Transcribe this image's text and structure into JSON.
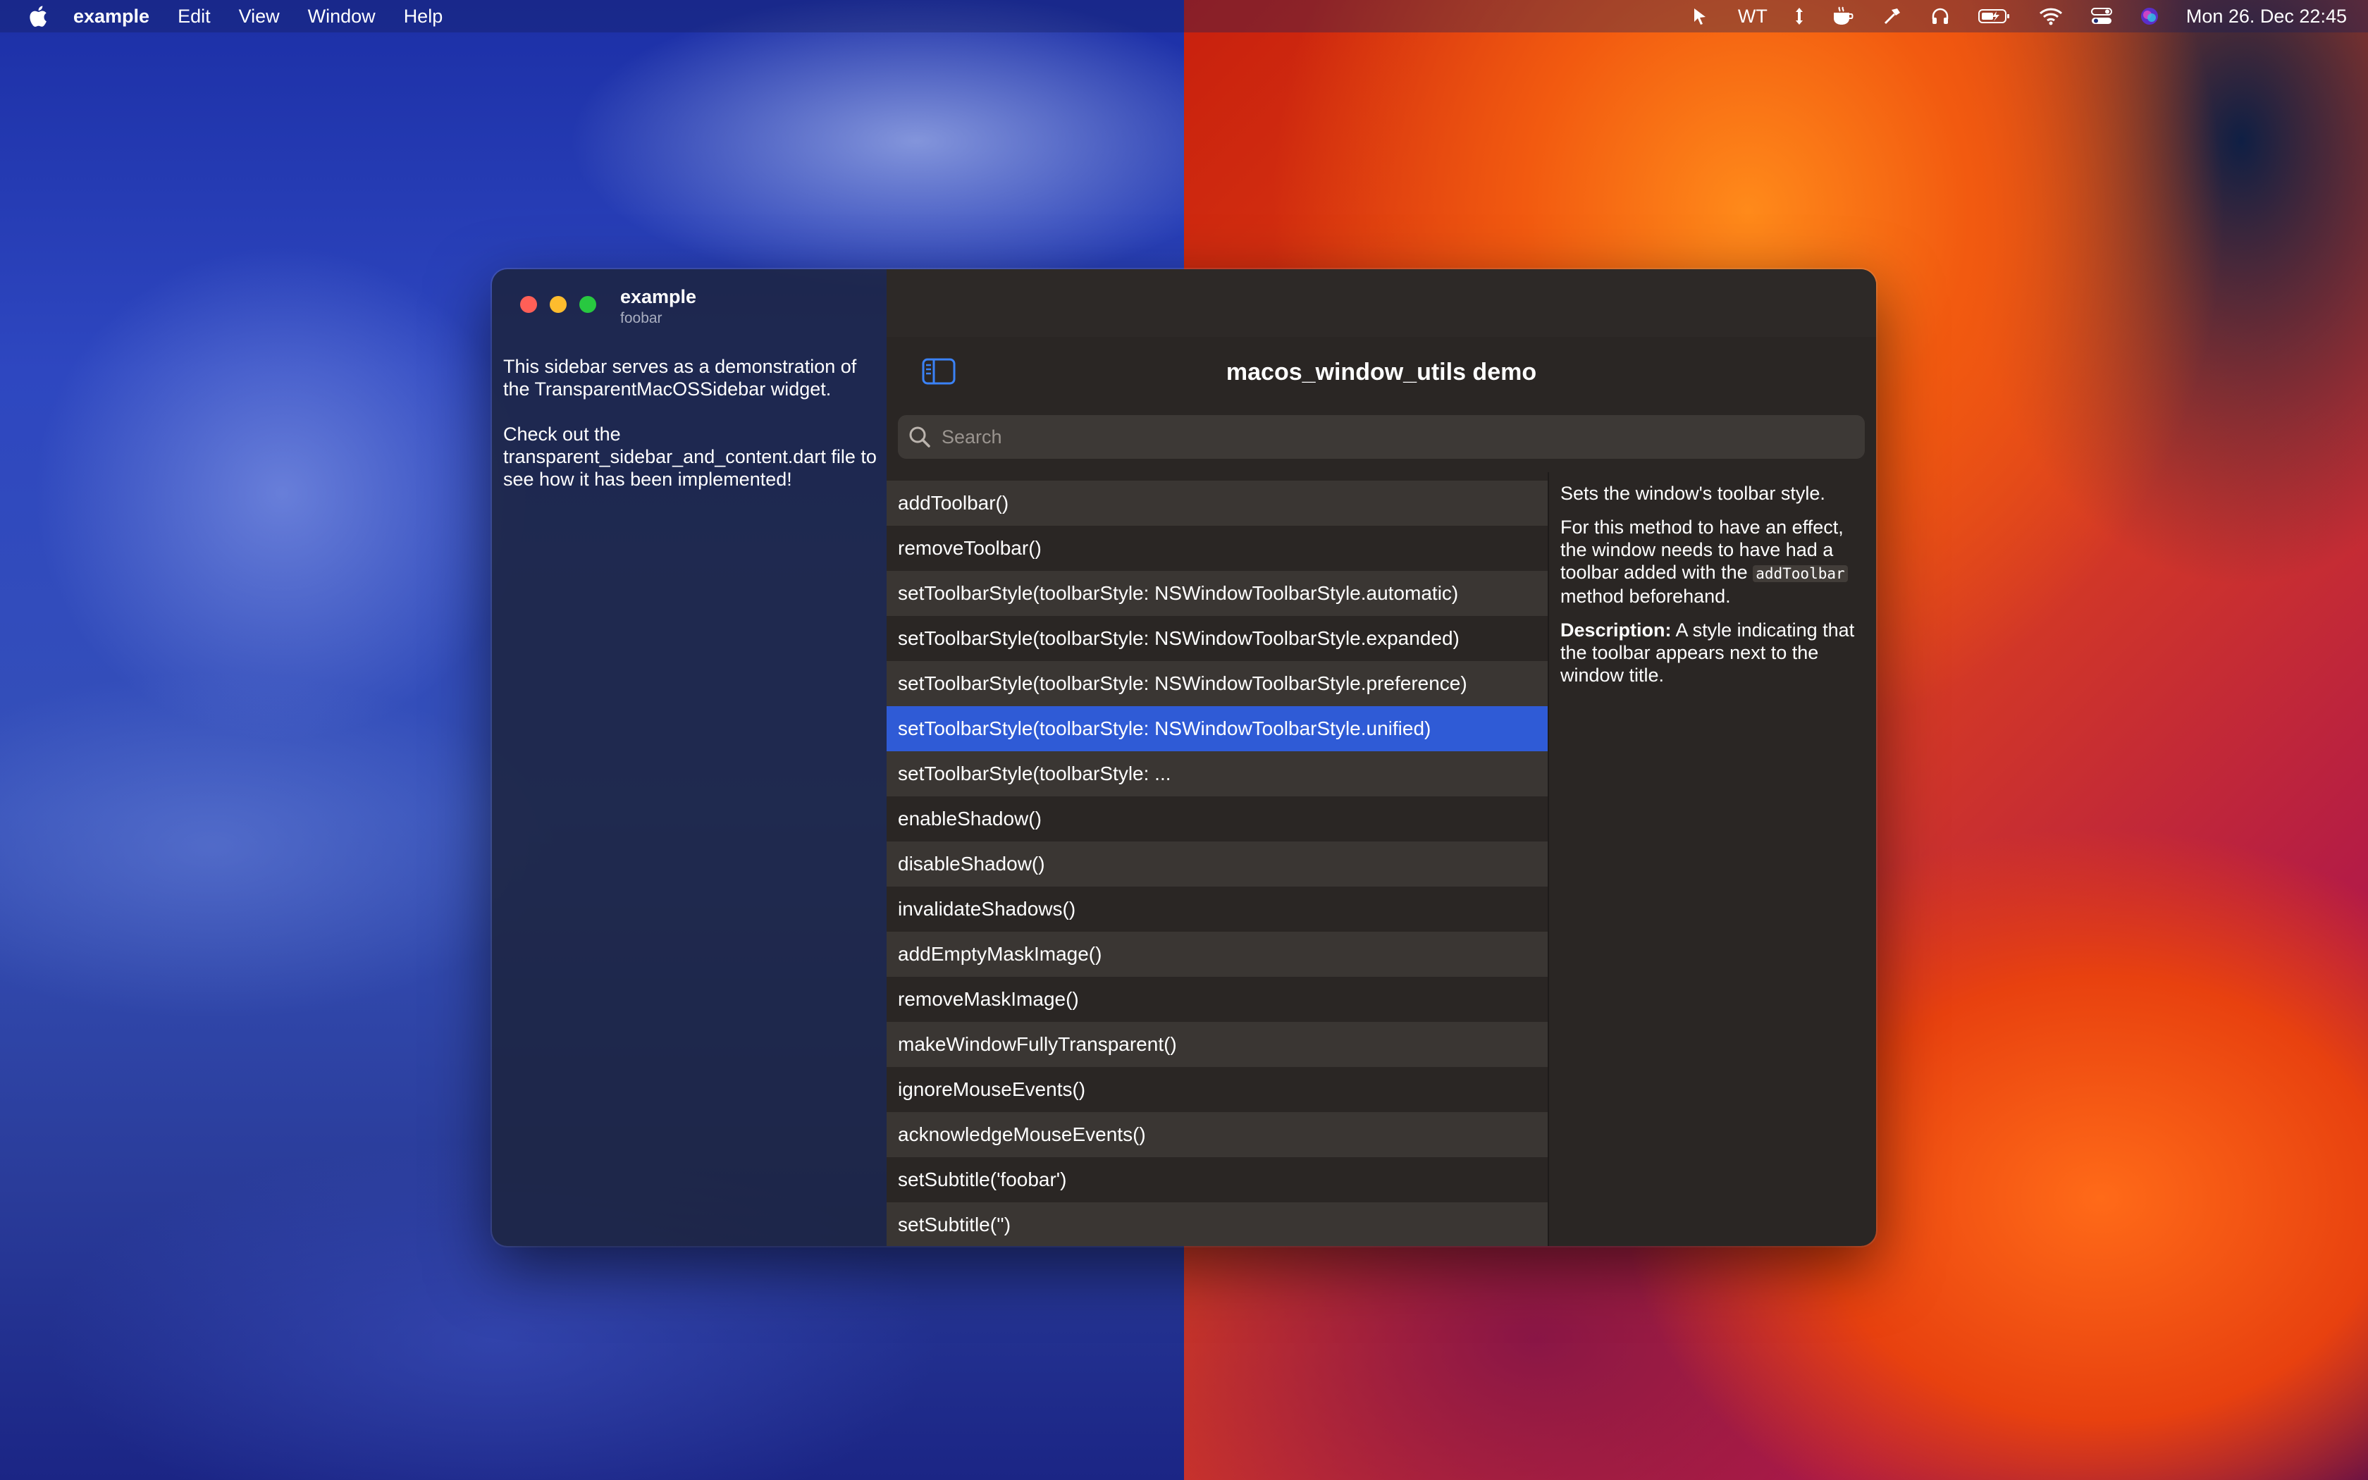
{
  "menubar": {
    "app_name": "example",
    "menus": [
      "Edit",
      "View",
      "Window",
      "Help"
    ],
    "status_text": "WT",
    "clock": "Mon 26. Dec  22:45"
  },
  "window": {
    "title": "example",
    "subtitle": "foobar",
    "sidebar_text_1": "This sidebar serves as a demonstration of the TransparentMacOSSidebar widget.",
    "sidebar_text_2": "Check out the transparent_sidebar_and_content.dart file to see how it has been implemented!",
    "page_title": "macos_window_utils demo",
    "search_placeholder": "Search"
  },
  "methods": [
    "addToolbar()",
    "removeToolbar()",
    "setToolbarStyle(toolbarStyle: NSWindowToolbarStyle.automatic)",
    "setToolbarStyle(toolbarStyle: NSWindowToolbarStyle.expanded)",
    "setToolbarStyle(toolbarStyle: NSWindowToolbarStyle.preference)",
    "setToolbarStyle(toolbarStyle: NSWindowToolbarStyle.unified)",
    "setToolbarStyle(toolbarStyle: ...",
    "enableShadow()",
    "disableShadow()",
    "invalidateShadows()",
    "addEmptyMaskImage()",
    "removeMaskImage()",
    "makeWindowFullyTransparent()",
    "ignoreMouseEvents()",
    "acknowledgeMouseEvents()",
    "setSubtitle('foobar')",
    "setSubtitle('')"
  ],
  "selected_index": 5,
  "details": {
    "summary": "Sets the window's toolbar style.",
    "effect_prefix": "For this method to have an effect, the window needs to have had a toolbar added with the",
    "effect_code": "addToolbar",
    "effect_suffix": "method beforehand.",
    "description_label": "Description:",
    "description_text": "A style indicating that the toolbar appears next to the window title."
  },
  "colors": {
    "accent": "#2f5bd6",
    "sidebar_toggle": "#3b82f6"
  }
}
